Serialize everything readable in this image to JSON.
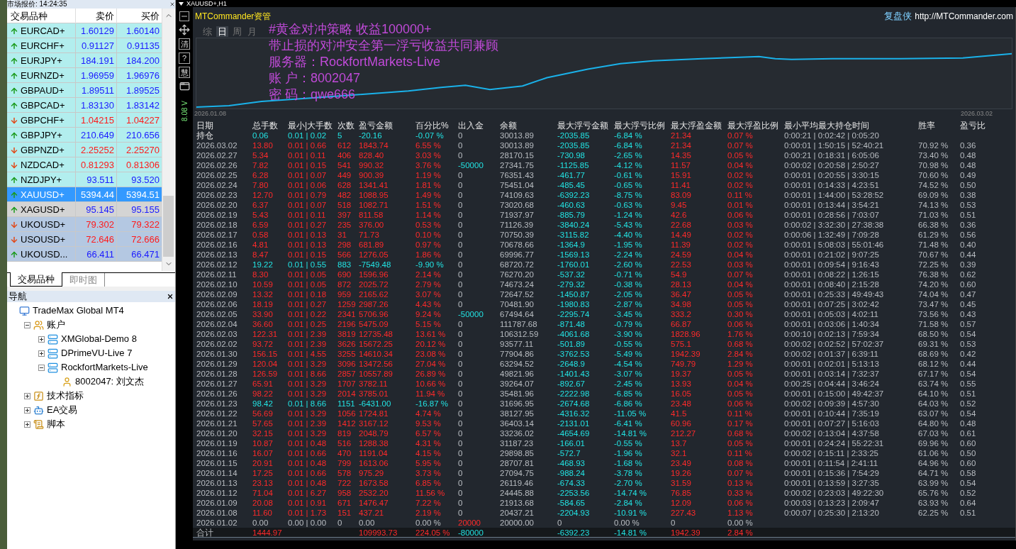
{
  "market_watch": {
    "title": "市场报价: 14:24:35",
    "columns": [
      "交易品种",
      "卖价",
      "买价"
    ],
    "rows": [
      {
        "symbol": "EURCAD+",
        "bid": "1.60129",
        "ask": "1.60140",
        "rising": true,
        "color": "#b2eeee",
        "selected": false
      },
      {
        "symbol": "EURCHF+",
        "bid": "0.91127",
        "ask": "0.91135",
        "rising": true,
        "color": "#b2eeee",
        "selected": false
      },
      {
        "symbol": "EURJPY+",
        "bid": "184.191",
        "ask": "184.200",
        "rising": true,
        "color": "#b2eeee",
        "selected": false
      },
      {
        "symbol": "EURNZD+",
        "bid": "1.96959",
        "ask": "1.96976",
        "rising": true,
        "color": "#b2eeee",
        "selected": false
      },
      {
        "symbol": "GBPAUD+",
        "bid": "1.89511",
        "ask": "1.89525",
        "rising": true,
        "color": "#b2eeee",
        "selected": false
      },
      {
        "symbol": "GBPCAD+",
        "bid": "1.83130",
        "ask": "1.83142",
        "rising": true,
        "color": "#b2eeee",
        "selected": false
      },
      {
        "symbol": "GBPCHF+",
        "bid": "1.04215",
        "ask": "1.04227",
        "rising": false,
        "color": "#b2eeee",
        "selected": false
      },
      {
        "symbol": "GBPJPY+",
        "bid": "210.649",
        "ask": "210.656",
        "rising": true,
        "color": "#b2eeee",
        "selected": false
      },
      {
        "symbol": "GBPNZD+",
        "bid": "2.25252",
        "ask": "2.25270",
        "rising": false,
        "color": "#b2eeee",
        "selected": false
      },
      {
        "symbol": "NZDCAD+",
        "bid": "0.81293",
        "ask": "0.81306",
        "rising": false,
        "color": "#b2eeee",
        "selected": false
      },
      {
        "symbol": "NZDJPY+",
        "bid": "93.511",
        "ask": "93.520",
        "rising": true,
        "color": "#b2eeee",
        "selected": false
      },
      {
        "symbol": "XAUUSD+",
        "bid": "5394.44",
        "ask": "5394.51",
        "rising": true,
        "color": "#3399ff",
        "selected": true
      },
      {
        "symbol": "XAGUSD+",
        "bid": "95.145",
        "ask": "95.155",
        "rising": true,
        "color": "#d4d4d4",
        "selected": false
      },
      {
        "symbol": "UKOUSD+",
        "bid": "79.302",
        "ask": "79.322",
        "rising": false,
        "color": "#b4c8e2",
        "selected": false
      },
      {
        "symbol": "USOUSD+",
        "bid": "72.646",
        "ask": "72.666",
        "rising": false,
        "color": "#b4c8e2",
        "selected": false
      },
      {
        "symbol": "UKOUSD...",
        "bid": "66.411",
        "ask": "66.471",
        "rising": true,
        "color": "#b4c8e2",
        "selected": false
      }
    ],
    "tabs": [
      {
        "label": "交易品种",
        "selected": true
      },
      {
        "label": "即时图",
        "selected": false
      }
    ]
  },
  "navigator": {
    "title": "导航",
    "tree": [
      {
        "label": "TradeMax Global MT4",
        "kind": "terminal",
        "children": [
          {
            "label": "账户",
            "kind": "accounts",
            "expanded": true,
            "children": [
              {
                "label": "XMGlobal-Demo 8",
                "kind": "server",
                "expanded": false
              },
              {
                "label": "DPrimeVU-Live 7",
                "kind": "server",
                "expanded": false
              },
              {
                "label": "RockfortMarkets-Live",
                "kind": "server",
                "expanded": true,
                "children": [
                  {
                    "label": "8002047: 刘文杰",
                    "kind": "account"
                  }
                ]
              }
            ]
          },
          {
            "label": "技术指标",
            "kind": "indicators",
            "expanded": false
          },
          {
            "label": "EA交易",
            "kind": "experts",
            "expanded": false
          },
          {
            "label": "脚本",
            "kind": "scripts",
            "expanded": false
          }
        ]
      }
    ]
  },
  "chart_window": {
    "title": "XAUUSD+,H1",
    "toolbar": [
      "清",
      "?",
      "慧"
    ],
    "side_label": "8.08 V"
  },
  "commander": {
    "brand": "MTCommander资管",
    "site_label": "复盘侠",
    "site_url": "http://MTCommander.com",
    "periods": [
      {
        "label": "综",
        "selected": false
      },
      {
        "label": "日",
        "selected": true
      },
      {
        "label": "周",
        "selected": false
      },
      {
        "label": "月",
        "selected": false
      }
    ],
    "overlay": [
      "#黄金对冲策略 收益100000+",
      "带止损的对冲安全第一浮亏收益共同兼顾",
      "服务器：RockfortMarkets-Live",
      "账 户：8002047",
      "密 码：qwe666"
    ],
    "equity_start": "2026.01.08",
    "equity_end": "2026.03.02",
    "table": {
      "columns": [
        "日期",
        "总手数",
        "最小|大手数",
        "次数",
        "盈亏金额",
        "百分比%",
        "出入金",
        "余额",
        "最大浮亏金额",
        "最大浮亏比例",
        "最大浮盈金额",
        "最大浮盈比例",
        "最小平均最大持仓时间",
        "胜率",
        "盈亏比"
      ],
      "rows": [
        {
          "kind": "position",
          "negative": true,
          "zero": false,
          "cells": [
            "持仓",
            "0.06",
            "0.01 | 0.02",
            "5",
            "-20.16",
            "-0.07 %",
            "0",
            "30013.89",
            "-2035.85",
            "-6.84 %",
            "21.34",
            "0.07 %",
            "0:00:21 | 0:02:42 | 0:05:20",
            null,
            null
          ]
        },
        {
          "kind": "day",
          "negative": false,
          "zero": false,
          "cells": [
            "2026.03.02",
            "13.80",
            "0.01 | 0.66",
            "612",
            "1843.74",
            "6.55 %",
            "0",
            "30013.89",
            "-2035.85",
            "-6.84 %",
            "21.34",
            "0.07 %",
            "0:00:01 | 1:50:15 | 52:40:21",
            "70.92 %",
            "0.36"
          ]
        },
        {
          "kind": "day",
          "negative": false,
          "zero": false,
          "cells": [
            "2026.02.27",
            "5.34",
            "0.01 | 0.11",
            "406",
            "828.40",
            "3.03 %",
            "0",
            "28170.15",
            "-730.98",
            "-2.65 %",
            "14.35",
            "0.05 %",
            "0:00:21 | 0:18:31 | 6:05:06",
            "73.40 %",
            "0.48"
          ]
        },
        {
          "kind": "day",
          "negative": false,
          "zero": false,
          "withdrawal": true,
          "cells": [
            "2026.02.26",
            "7.82",
            "0.01 | 0.15",
            "541",
            "990.32",
            "3.76 %",
            "-50000",
            "27341.75",
            "-1125.85",
            "-4.12 %",
            "11.57",
            "0.04 %",
            "0:00:02 | 0:20:58 | 2:50:27",
            "70.98 %",
            "0.48"
          ]
        },
        {
          "kind": "day",
          "negative": false,
          "zero": false,
          "cells": [
            "2026.02.25",
            "6.28",
            "0.01 | 0.07",
            "449",
            "900.39",
            "1.19 %",
            "0",
            "76351.43",
            "-461.77",
            "-0.61 %",
            "15.91",
            "0.02 %",
            "0:00:01 | 0:20:55 | 3:30:15",
            "70.60 %",
            "0.49"
          ]
        },
        {
          "kind": "day",
          "negative": false,
          "zero": false,
          "cells": [
            "2026.02.24",
            "7.80",
            "0.01 | 0.06",
            "628",
            "1341.41",
            "1.81 %",
            "0",
            "75451.04",
            "-485.45",
            "-0.65 %",
            "11.41",
            "0.02 %",
            "0:00:01 | 0:14:33 | 4:23:51",
            "74.52 %",
            "0.50"
          ]
        },
        {
          "kind": "day",
          "negative": false,
          "zero": false,
          "cells": [
            "2026.02.23",
            "12.70",
            "0.01 | 0.79",
            "482",
            "1088.95",
            "1.49 %",
            "0",
            "74109.63",
            "-6392.23",
            "-8.75 %",
            "83.09",
            "0.11 %",
            "0:00:01 | 1:44:00 | 53:28:52",
            "69.09 %",
            "0.38"
          ]
        },
        {
          "kind": "day",
          "negative": false,
          "zero": false,
          "cells": [
            "2026.02.20",
            "6.37",
            "0.01 | 0.07",
            "518",
            "1082.71",
            "1.51 %",
            "0",
            "73020.68",
            "-460.63",
            "-0.63 %",
            "9.45",
            "0.01 %",
            "0:00:01 | 0:13:44 | 3:54:21",
            "74.13 %",
            "0.53"
          ]
        },
        {
          "kind": "day",
          "negative": false,
          "zero": false,
          "cells": [
            "2026.02.19",
            "5.43",
            "0.01 | 0.11",
            "397",
            "811.58",
            "1.14 %",
            "0",
            "71937.97",
            "-885.79",
            "-1.24 %",
            "42.6",
            "0.06 %",
            "0:00:01 | 0:28:56 | 7:03:07",
            "71.03 %",
            "0.51"
          ]
        },
        {
          "kind": "day",
          "negative": false,
          "zero": false,
          "cells": [
            "2026.02.18",
            "6.59",
            "0.01 | 0.27",
            "235",
            "376.00",
            "0.53 %",
            "0",
            "71126.39",
            "-3840.24",
            "-5.43 %",
            "22.68",
            "0.03 %",
            "0:00:02 | 3:32:30 | 27:38:38",
            "66.38 %",
            "0.36"
          ]
        },
        {
          "kind": "day",
          "negative": false,
          "zero": false,
          "cells": [
            "2026.02.17",
            "0.58",
            "0.01 | 0.13",
            "31",
            "71.73",
            "0.10 %",
            "0",
            "70750.39",
            "-3115.82",
            "-4.40 %",
            "14.49",
            "0.02 %",
            "0:00:06 | 1:32:49 | 7:09:28",
            "61.29 %",
            "0.56"
          ]
        },
        {
          "kind": "day",
          "negative": false,
          "zero": false,
          "cells": [
            "2026.02.16",
            "4.81",
            "0.01 | 0.13",
            "298",
            "681.89",
            "0.97 %",
            "0",
            "70678.66",
            "-1364.9",
            "-1.95 %",
            "11.39",
            "0.02 %",
            "0:00:01 | 5:08:03 | 55:01:46",
            "71.48 %",
            "0.40"
          ]
        },
        {
          "kind": "day",
          "negative": false,
          "zero": false,
          "cells": [
            "2026.02.13",
            "8.47",
            "0.01 | 0.15",
            "566",
            "1276.05",
            "1.86 %",
            "0",
            "69996.77",
            "-1569.13",
            "-2.24 %",
            "24.59",
            "0.04 %",
            "0:00:01 | 0:21:02 | 9:07:25",
            "70.67 %",
            "0.44"
          ]
        },
        {
          "kind": "day",
          "negative": true,
          "zero": false,
          "cells": [
            "2026.02.12",
            "19.22",
            "0.01 | 0.55",
            "883",
            "-7549.48",
            "-9.90 %",
            "0",
            "68720.72",
            "-1760.01",
            "-2.60 %",
            "22.53",
            "0.03 %",
            "0:00:01 | 0:09:54 | 9:16:43",
            "72.25 %",
            "0.39"
          ]
        },
        {
          "kind": "day",
          "negative": false,
          "zero": false,
          "cells": [
            "2026.02.11",
            "8.30",
            "0.01 | 0.05",
            "690",
            "1596.96",
            "2.14 %",
            "0",
            "76270.20",
            "-537.32",
            "-0.71 %",
            "54.9",
            "0.07 %",
            "0:00:01 | 0:08:22 | 1:26:15",
            "76.38 %",
            "0.62"
          ]
        },
        {
          "kind": "day",
          "negative": false,
          "zero": false,
          "cells": [
            "2026.02.10",
            "10.59",
            "0.01 | 0.05",
            "872",
            "2025.72",
            "2.79 %",
            "0",
            "74673.24",
            "-279.32",
            "-0.38 %",
            "28.13",
            "0.04 %",
            "0:00:01 | 0:08:40 | 2:15:28",
            "74.20 %",
            "0.60"
          ]
        },
        {
          "kind": "day",
          "negative": false,
          "zero": false,
          "cells": [
            "2026.02.09",
            "13.32",
            "0.01 | 0.18",
            "959",
            "2165.62",
            "3.07 %",
            "0",
            "72647.52",
            "-1450.87",
            "-2.05 %",
            "36.47",
            "0.05 %",
            "0:00:01 | 0:25:33 | 49:49:43",
            "74.04 %",
            "0.47"
          ]
        },
        {
          "kind": "day",
          "negative": false,
          "zero": false,
          "cells": [
            "2026.02.06",
            "18.19",
            "0.01 | 0.27",
            "1259",
            "2987.26",
            "4.43 %",
            "0",
            "70481.90",
            "-1980.83",
            "-2.87 %",
            "34.98",
            "0.05 %",
            "0:00:01 | 0:07:25 | 3:02:42",
            "73.47 %",
            "0.45"
          ]
        },
        {
          "kind": "day",
          "negative": false,
          "zero": false,
          "withdrawal": true,
          "cells": [
            "2026.02.05",
            "33.90",
            "0.01 | 0.22",
            "2341",
            "5706.96",
            "9.24 %",
            "-50000",
            "67494.64",
            "-2295.74",
            "-3.45 %",
            "333.2",
            "0.30 %",
            "0:00:01 | 0:05:03 | 4:02:11",
            "73.56 %",
            "0.43"
          ]
        },
        {
          "kind": "day",
          "negative": false,
          "zero": false,
          "cells": [
            "2026.02.04",
            "36.60",
            "0.01 | 0.25",
            "2196",
            "5475.09",
            "5.15 %",
            "0",
            "111787.68",
            "-871.48",
            "-0.79 %",
            "66.87",
            "0.06 %",
            "0:00:01 | 0:03:06 | 1:40:34",
            "71.58 %",
            "0.57"
          ]
        },
        {
          "kind": "day",
          "negative": false,
          "zero": false,
          "cells": [
            "2026.02.03",
            "122.31",
            "0.01 | 2.39",
            "3819",
            "12735.48",
            "13.61 %",
            "0",
            "106312.59",
            "-4061.68",
            "-3.90 %",
            "1828.96",
            "1.76 %",
            "0:00:10 | 0:02:13 | 7:59:34",
            "68.50 %",
            "0.54"
          ]
        },
        {
          "kind": "day",
          "negative": false,
          "zero": false,
          "cells": [
            "2026.02.02",
            "93.72",
            "0.01 | 2.39",
            "3626",
            "15672.25",
            "20.12 %",
            "0",
            "93577.11",
            "-501.89",
            "-0.55 %",
            "575.1",
            "0.68 %",
            "0:00:02 | 0:02:52 | 57:02:37",
            "69.31 %",
            "0.53"
          ]
        },
        {
          "kind": "day",
          "negative": false,
          "zero": false,
          "cells": [
            "2026.01.30",
            "156.15",
            "0.01 | 4.55",
            "3255",
            "14610.34",
            "23.08 %",
            "0",
            "77904.86",
            "-3762.53",
            "-5.49 %",
            "1942.39",
            "2.84 %",
            "0:00:02 | 0:01:37 | 6:39:11",
            "68.69 %",
            "0.42"
          ]
        },
        {
          "kind": "day",
          "negative": false,
          "zero": false,
          "cells": [
            "2026.01.29",
            "120.04",
            "0.01 | 3.29",
            "3096",
            "13472.56",
            "27.04 %",
            "0",
            "63294.52",
            "-2648.9",
            "-4.54 %",
            "749.79",
            "1.29 %",
            "0:00:01 | 0:02:01 | 5:13:13",
            "68.12 %",
            "0.44"
          ]
        },
        {
          "kind": "day",
          "negative": false,
          "zero": false,
          "cells": [
            "2026.01.28",
            "126.59",
            "0.01 | 8.66",
            "2857",
            "10557.89",
            "26.89 %",
            "0",
            "49821.96",
            "-1401.43",
            "-3.07 %",
            "19.37",
            "0.05 %",
            "0:00:01 | 0:03:14 | 7:32:37",
            "67.17 %",
            "0.54"
          ]
        },
        {
          "kind": "day",
          "negative": false,
          "zero": false,
          "cells": [
            "2026.01.27",
            "65.91",
            "0.01 | 3.29",
            "1707",
            "3782.11",
            "10.66 %",
            "0",
            "39264.07",
            "-892.67",
            "-2.45 %",
            "13.93",
            "0.04 %",
            "0:00:25 | 0:04:44 | 3:46:24",
            "63.74 %",
            "0.55"
          ]
        },
        {
          "kind": "day",
          "negative": false,
          "zero": false,
          "cells": [
            "2026.01.26",
            "98.22",
            "0.01 | 3.29",
            "2014",
            "3785.01",
            "11.94 %",
            "0",
            "35481.96",
            "-2222.98",
            "-6.85 %",
            "16.05",
            "0.05 %",
            "0:00:01 | 0:15:00 | 49:42:37",
            "64.10 %",
            "0.51"
          ]
        },
        {
          "kind": "day",
          "negative": true,
          "zero": false,
          "cells": [
            "2026.01.23",
            "98.42",
            "0.01 | 8.66",
            "1151",
            "-6431.00",
            "-16.87 %",
            "0",
            "31696.95",
            "-2674.68",
            "-6.86 %",
            "23.48",
            "0.06 %",
            "0:00:02 | 0:09:39 | 4:57:30",
            "64.03 %",
            "0.52"
          ]
        },
        {
          "kind": "day",
          "negative": false,
          "zero": false,
          "cells": [
            "2026.01.22",
            "56.69",
            "0.01 | 3.29",
            "1056",
            "1724.81",
            "4.74 %",
            "0",
            "38127.95",
            "-4316.32",
            "-11.05 %",
            "41.5",
            "0.11 %",
            "0:00:01 | 0:10:44 | 7:35:19",
            "63.07 %",
            "0.54"
          ]
        },
        {
          "kind": "day",
          "negative": false,
          "zero": false,
          "cells": [
            "2026.01.21",
            "57.65",
            "0.01 | 2.39",
            "1412",
            "3167.12",
            "9.53 %",
            "0",
            "36403.14",
            "-2131.01",
            "-6.41 %",
            "60.96",
            "0.17 %",
            "0:00:01 | 0:07:27 | 5:16:03",
            "64.80 %",
            "0.48"
          ]
        },
        {
          "kind": "day",
          "negative": false,
          "zero": false,
          "cells": [
            "2026.01.20",
            "32.15",
            "0.01 | 3.29",
            "819",
            "2048.79",
            "6.57 %",
            "0",
            "33236.02",
            "-4654.69",
            "-14.81 %",
            "212.27",
            "0.68 %",
            "0:00:02 | 0:13:04 | 4:37:58",
            "67.03 %",
            "0.61"
          ]
        },
        {
          "kind": "day",
          "negative": false,
          "zero": false,
          "cells": [
            "2026.01.19",
            "10.87",
            "0.01 | 0.48",
            "516",
            "1288.38",
            "4.31 %",
            "0",
            "31187.23",
            "-166.01",
            "-0.55 %",
            "13.7",
            "0.05 %",
            "0:00:01 | 0:24:24 | 55:22:31",
            "69.96 %",
            "0.60"
          ]
        },
        {
          "kind": "day",
          "negative": false,
          "zero": false,
          "cells": [
            "2026.01.16",
            "16.07",
            "0.01 | 0.66",
            "470",
            "1191.04",
            "4.15 %",
            "0",
            "29898.85",
            "-572.7",
            "-1.96 %",
            "32.1",
            "0.11 %",
            "0:00:02 | 0:15:11 | 2:33:25",
            "61.06 %",
            "0.50"
          ]
        },
        {
          "kind": "day",
          "negative": false,
          "zero": false,
          "cells": [
            "2026.01.15",
            "20.91",
            "0.01 | 0.48",
            "799",
            "1613.06",
            "5.95 %",
            "0",
            "28707.81",
            "-468.93",
            "-1.68 %",
            "23.49",
            "0.08 %",
            "0:00:01 | 0:11:54 | 2:41:11",
            "64.96 %",
            "0.60"
          ]
        },
        {
          "kind": "day",
          "negative": false,
          "zero": false,
          "cells": [
            "2026.01.14",
            "17.25",
            "0.01 | 0.66",
            "578",
            "975.29",
            "3.73 %",
            "0",
            "27094.75",
            "-988.24",
            "-3.78 %",
            "19.26",
            "0.07 %",
            "0:00:01 | 0:15:36 | 7:54:29",
            "64.71 %",
            "0.58"
          ]
        },
        {
          "kind": "day",
          "negative": false,
          "zero": false,
          "cells": [
            "2026.01.13",
            "23.13",
            "0.01 | 0.48",
            "722",
            "1673.58",
            "6.85 %",
            "0",
            "26119.46",
            "-674.33",
            "-2.70 %",
            "31.59",
            "0.13 %",
            "0:00:01 | 0:13:59 | 3:27:35",
            "63.99 %",
            "0.54"
          ]
        },
        {
          "kind": "day",
          "negative": false,
          "zero": false,
          "cells": [
            "2026.01.12",
            "71.04",
            "0.01 | 6.27",
            "958",
            "2532.20",
            "11.56 %",
            "0",
            "24445.88",
            "-2253.56",
            "-14.74 %",
            "76.85",
            "0.33 %",
            "0:00:02 | 0:23:03 | 49:22:30",
            "65.76 %",
            "0.52"
          ]
        },
        {
          "kind": "day",
          "negative": false,
          "zero": false,
          "cells": [
            "2026.01.09",
            "20.08",
            "0.01 | 0.91",
            "671",
            "1476.47",
            "7.22 %",
            "0",
            "21913.68",
            "-584.65",
            "-2.84 %",
            "12.09",
            "0.06 %",
            "0:00:03 | 0:13:23 | 2:09:47",
            "63.93 %",
            "0.64"
          ]
        },
        {
          "kind": "day",
          "negative": false,
          "zero": false,
          "cells": [
            "2026.01.08",
            "11.60",
            "0.01 | 1.73",
            "151",
            "437.21",
            "2.19 %",
            "0",
            "20437.21",
            "-2204.93",
            "-10.91 %",
            "227.43",
            "1.13 %",
            "0:00:07 | 0:25:30 | 2:13:20",
            "62.25 %",
            "0.51"
          ]
        },
        {
          "kind": "day",
          "zero": true,
          "deposit": true,
          "cells": [
            "2026.01.02",
            "0.00",
            "0.00 | 0.00",
            "0",
            "0.00",
            "0.00 %",
            "20000",
            "20000.00",
            "0",
            "0.00 %",
            "0",
            "0.00 %",
            null,
            null,
            null
          ]
        },
        {
          "kind": "total",
          "negative": false,
          "zero": false,
          "withdrawal": true,
          "cells": [
            "合计",
            "1444.97",
            null,
            null,
            "109993.73",
            "224.05 %",
            "-80000",
            null,
            "-6392.23",
            "-14.81 %",
            "1942.39",
            "2.84 %",
            null,
            null,
            null
          ]
        }
      ]
    }
  }
}
